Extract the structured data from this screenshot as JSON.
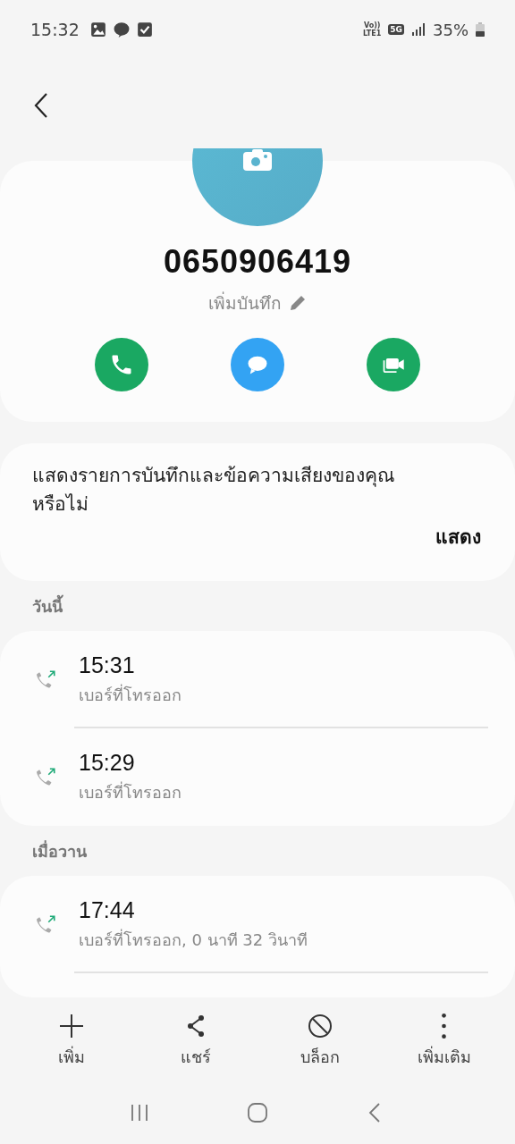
{
  "status_bar": {
    "time": "15:32",
    "network_top": "Vo))",
    "network_bottom": "LTE1",
    "network_type": "5G",
    "battery": "35%"
  },
  "contact": {
    "number": "0650906419",
    "note_placeholder": "เพิ่มบันทึก"
  },
  "prompt": {
    "text": "แสดงรายการบันทึกและข้อความเสียงของคุณหรือไม่",
    "action": "แสดง"
  },
  "groups": [
    {
      "label": "วันนี้",
      "calls": [
        {
          "time": "15:31",
          "detail": "เบอร์ที่โทรออก",
          "kind": "outgoing"
        },
        {
          "time": "15:29",
          "detail": "เบอร์ที่โทรออก",
          "kind": "outgoing"
        }
      ]
    },
    {
      "label": "เมื่อวาน",
      "calls": [
        {
          "time": "17:44",
          "detail": "เบอร์ที่โทรออก, 0 นาที 32 วินาที",
          "kind": "outgoing"
        }
      ]
    }
  ],
  "toolbar": [
    {
      "label": "เพิ่ม",
      "kind": "add"
    },
    {
      "label": "แชร์",
      "kind": "share"
    },
    {
      "label": "บล็อก",
      "kind": "block"
    },
    {
      "label": "เพิ่มเติม",
      "kind": "more"
    }
  ]
}
